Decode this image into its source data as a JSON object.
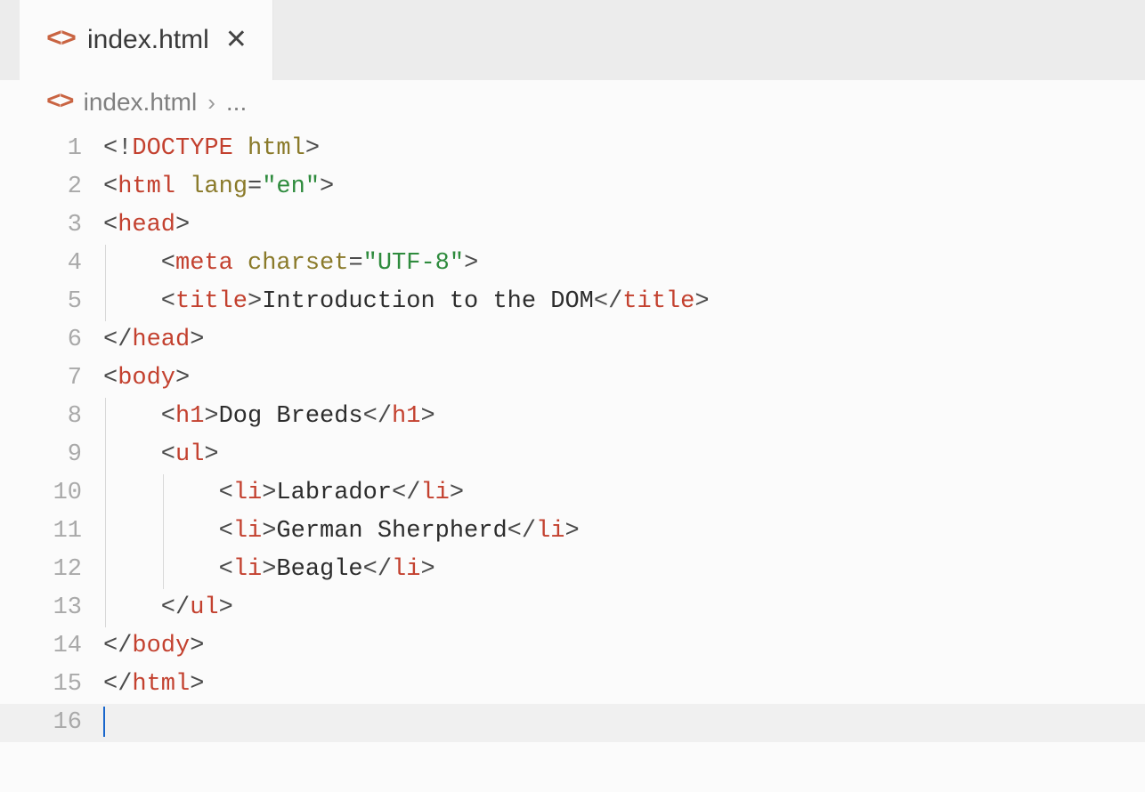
{
  "tab": {
    "filename": "index.html",
    "icon_glyph": "<>"
  },
  "breadcrumb": {
    "filename": "index.html",
    "icon_glyph": "<>",
    "separator": "›",
    "rest": "..."
  },
  "code": {
    "indent_unit": 4,
    "lines": [
      {
        "num": 1,
        "guides": 0,
        "indent": 0,
        "current": false,
        "tokens": [
          {
            "c": "punct",
            "t": "<!"
          },
          {
            "c": "doctype",
            "t": "DOCTYPE"
          },
          {
            "c": "text",
            "t": " "
          },
          {
            "c": "attr",
            "t": "html"
          },
          {
            "c": "punct",
            "t": ">"
          }
        ]
      },
      {
        "num": 2,
        "guides": 0,
        "indent": 0,
        "current": false,
        "tokens": [
          {
            "c": "punct",
            "t": "<"
          },
          {
            "c": "tag",
            "t": "html"
          },
          {
            "c": "text",
            "t": " "
          },
          {
            "c": "attr",
            "t": "lang"
          },
          {
            "c": "punct",
            "t": "="
          },
          {
            "c": "string",
            "t": "\"en\""
          },
          {
            "c": "punct",
            "t": ">"
          }
        ]
      },
      {
        "num": 3,
        "guides": 0,
        "indent": 0,
        "current": false,
        "tokens": [
          {
            "c": "punct",
            "t": "<"
          },
          {
            "c": "tag",
            "t": "head"
          },
          {
            "c": "punct",
            "t": ">"
          }
        ]
      },
      {
        "num": 4,
        "guides": 1,
        "indent": 1,
        "current": false,
        "tokens": [
          {
            "c": "punct",
            "t": "<"
          },
          {
            "c": "tag",
            "t": "meta"
          },
          {
            "c": "text",
            "t": " "
          },
          {
            "c": "attr",
            "t": "charset"
          },
          {
            "c": "punct",
            "t": "="
          },
          {
            "c": "string",
            "t": "\"UTF-8\""
          },
          {
            "c": "punct",
            "t": ">"
          }
        ]
      },
      {
        "num": 5,
        "guides": 1,
        "indent": 1,
        "current": false,
        "tokens": [
          {
            "c": "punct",
            "t": "<"
          },
          {
            "c": "tag",
            "t": "title"
          },
          {
            "c": "punct",
            "t": ">"
          },
          {
            "c": "text",
            "t": "Introduction to the DOM"
          },
          {
            "c": "punct",
            "t": "</"
          },
          {
            "c": "tag",
            "t": "title"
          },
          {
            "c": "punct",
            "t": ">"
          }
        ]
      },
      {
        "num": 6,
        "guides": 0,
        "indent": 0,
        "current": false,
        "tokens": [
          {
            "c": "punct",
            "t": "</"
          },
          {
            "c": "tag",
            "t": "head"
          },
          {
            "c": "punct",
            "t": ">"
          }
        ]
      },
      {
        "num": 7,
        "guides": 0,
        "indent": 0,
        "current": false,
        "tokens": [
          {
            "c": "punct",
            "t": "<"
          },
          {
            "c": "tag",
            "t": "body"
          },
          {
            "c": "punct",
            "t": ">"
          }
        ]
      },
      {
        "num": 8,
        "guides": 1,
        "indent": 1,
        "current": false,
        "tokens": [
          {
            "c": "punct",
            "t": "<"
          },
          {
            "c": "tag",
            "t": "h1"
          },
          {
            "c": "punct",
            "t": ">"
          },
          {
            "c": "text",
            "t": "Dog Breeds"
          },
          {
            "c": "punct",
            "t": "</"
          },
          {
            "c": "tag",
            "t": "h1"
          },
          {
            "c": "punct",
            "t": ">"
          }
        ]
      },
      {
        "num": 9,
        "guides": 1,
        "indent": 1,
        "current": false,
        "tokens": [
          {
            "c": "punct",
            "t": "<"
          },
          {
            "c": "tag",
            "t": "ul"
          },
          {
            "c": "punct",
            "t": ">"
          }
        ]
      },
      {
        "num": 10,
        "guides": 2,
        "indent": 2,
        "current": false,
        "tokens": [
          {
            "c": "punct",
            "t": "<"
          },
          {
            "c": "tag",
            "t": "li"
          },
          {
            "c": "punct",
            "t": ">"
          },
          {
            "c": "text",
            "t": "Labrador"
          },
          {
            "c": "punct",
            "t": "</"
          },
          {
            "c": "tag",
            "t": "li"
          },
          {
            "c": "punct",
            "t": ">"
          }
        ]
      },
      {
        "num": 11,
        "guides": 2,
        "indent": 2,
        "current": false,
        "tokens": [
          {
            "c": "punct",
            "t": "<"
          },
          {
            "c": "tag",
            "t": "li"
          },
          {
            "c": "punct",
            "t": ">"
          },
          {
            "c": "text",
            "t": "German Sherpherd"
          },
          {
            "c": "punct",
            "t": "</"
          },
          {
            "c": "tag",
            "t": "li"
          },
          {
            "c": "punct",
            "t": ">"
          }
        ]
      },
      {
        "num": 12,
        "guides": 2,
        "indent": 2,
        "current": false,
        "tokens": [
          {
            "c": "punct",
            "t": "<"
          },
          {
            "c": "tag",
            "t": "li"
          },
          {
            "c": "punct",
            "t": ">"
          },
          {
            "c": "text",
            "t": "Beagle"
          },
          {
            "c": "punct",
            "t": "</"
          },
          {
            "c": "tag",
            "t": "li"
          },
          {
            "c": "punct",
            "t": ">"
          }
        ]
      },
      {
        "num": 13,
        "guides": 1,
        "indent": 1,
        "current": false,
        "tokens": [
          {
            "c": "punct",
            "t": "</"
          },
          {
            "c": "tag",
            "t": "ul"
          },
          {
            "c": "punct",
            "t": ">"
          }
        ]
      },
      {
        "num": 14,
        "guides": 0,
        "indent": 0,
        "current": false,
        "tokens": [
          {
            "c": "punct",
            "t": "</"
          },
          {
            "c": "tag",
            "t": "body"
          },
          {
            "c": "punct",
            "t": ">"
          }
        ]
      },
      {
        "num": 15,
        "guides": 0,
        "indent": 0,
        "current": false,
        "tokens": [
          {
            "c": "punct",
            "t": "</"
          },
          {
            "c": "tag",
            "t": "html"
          },
          {
            "c": "punct",
            "t": ">"
          }
        ]
      },
      {
        "num": 16,
        "guides": 0,
        "indent": 0,
        "current": true,
        "cursor": true,
        "tokens": []
      }
    ]
  }
}
